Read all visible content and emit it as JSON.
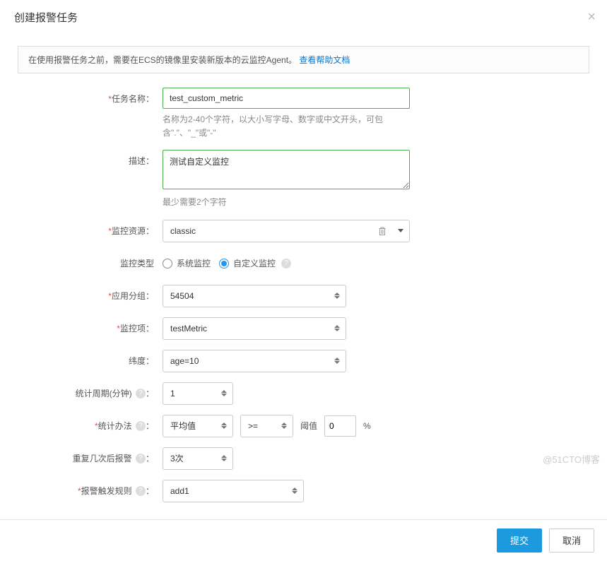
{
  "modal": {
    "title": "创建报警任务",
    "info_text": "在使用报警任务之前，需要在ECS的镜像里安装新版本的云监控Agent。",
    "info_link": "查看帮助文档"
  },
  "form": {
    "task_name": {
      "label": "任务名称",
      "value": "test_custom_metric",
      "hint": "名称为2-40个字符，以大小写字母、数字或中文开头，可包含\".\"、\"_\"或\"-\""
    },
    "description": {
      "label": "描述",
      "value": "测试自定义监控",
      "hint": "最少需要2个字符"
    },
    "resource": {
      "label": "监控资源",
      "value": "classic"
    },
    "monitor_type": {
      "label": "监控类型",
      "options": [
        {
          "label": "系统监控",
          "checked": false
        },
        {
          "label": "自定义监控",
          "checked": true
        }
      ]
    },
    "app_group": {
      "label": "应用分组",
      "value": "54504"
    },
    "metric_item": {
      "label": "监控项",
      "value": "testMetric"
    },
    "dimension": {
      "label": "纬度",
      "value": "age=10"
    },
    "period": {
      "label": "统计周期(分钟)",
      "value": "1"
    },
    "statistic": {
      "label": "统计办法",
      "method": "平均值",
      "comparator": ">=",
      "threshold_label": "阈值",
      "threshold_value": "0",
      "unit": "%"
    },
    "repeat": {
      "label": "重复几次后报警",
      "value": "3次"
    },
    "rule": {
      "label": "报警触发规则",
      "value": "add1"
    }
  },
  "footer": {
    "submit": "提交",
    "cancel": "取消"
  },
  "watermark": "@51CTO博客"
}
